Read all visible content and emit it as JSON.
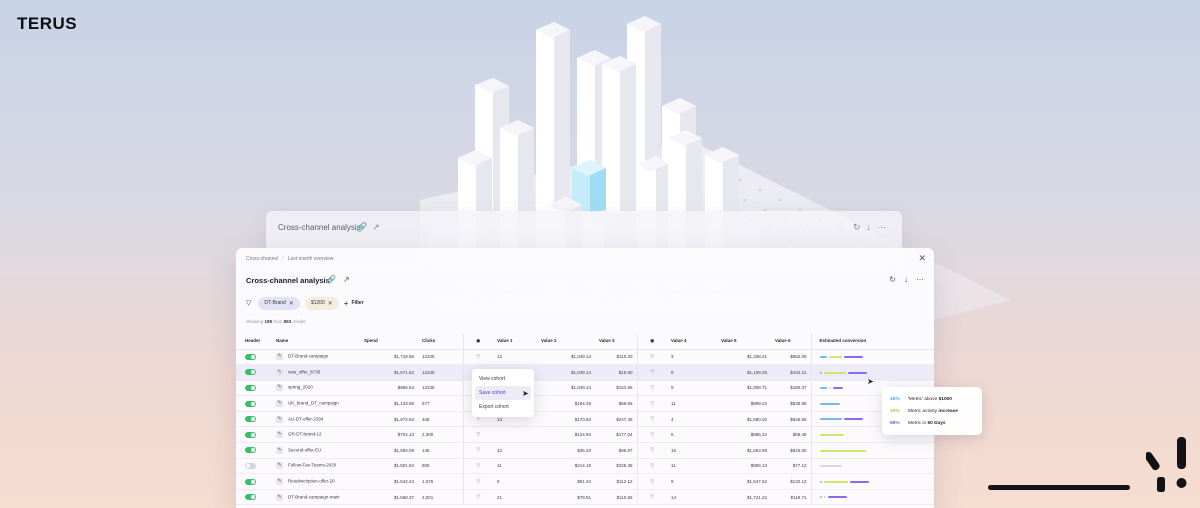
{
  "brand": "TERUS",
  "back_panel": {
    "title": "Cross-channel analysis"
  },
  "breadcrumb": {
    "root": "Cross-channel",
    "current": "Last month overview"
  },
  "panel": {
    "title": "Cross-channel analysis"
  },
  "filters": {
    "chips": [
      "DT-Brand",
      "$1200"
    ],
    "add_label": "Filter"
  },
  "results": {
    "prefix": "Showing",
    "shown": "198",
    "middle": "from",
    "total": "893",
    "suffix": "results"
  },
  "columns": [
    "Header",
    "Name",
    "Spend",
    "Clicks",
    "Value 1",
    "Value 2",
    "Value 3",
    "Value 4",
    "Value 5",
    "Value 6",
    "Estimated conversion"
  ],
  "rows": [
    {
      "on": true,
      "name": "DT-Brand-campaign",
      "spend": "$1,718.56",
      "clicks": "12345",
      "v1": "12",
      "v2": "$1,049.14",
      "v3": "$110.20",
      "v4": "3",
      "v5": "$1,338.21",
      "v6": "$652.08"
    },
    {
      "on": true,
      "name": "new_offer_8735",
      "spend": "$1,571.63",
      "clicks": "12345",
      "v1": "",
      "v2": "$1,049.14",
      "v3": "$15.50",
      "v4": "8",
      "v5": "$1,109.25",
      "v6": "$434.21"
    },
    {
      "on": true,
      "name": "spring_2020",
      "spend": "$956.54",
      "clicks": "12345",
      "v1": "",
      "v2": "$1,049.14",
      "v3": "$154.96",
      "v4": "9",
      "v5": "$1,008.71",
      "v6": "$180.37"
    },
    {
      "on": true,
      "name": "UK_brand_DT_campaign",
      "spend": "$1,133.69",
      "clicks": "677",
      "v1": "",
      "v2": "$194.49",
      "v3": "$69.66",
      "v4": "11",
      "v5": "$899.23",
      "v6": "$538.98"
    },
    {
      "on": true,
      "name": "AU-DT-offer-2394",
      "spend": "$1,672.93",
      "clicks": "348",
      "v1": "13",
      "v2": "$170.63",
      "v3": "$247.49",
      "v4": "4",
      "v5": "$1,580.02",
      "v6": "$945.56"
    },
    {
      "on": true,
      "name": "GR-DT-brand-12",
      "spend": "$704.13",
      "clicks": "2,300",
      "v1": "",
      "v2": "$124.94",
      "v3": "$177.04",
      "v4": "6",
      "v5": "$886.22",
      "v6": "$68.49"
    },
    {
      "on": true,
      "name": "Second-offer-EU",
      "spend": "$1,694.09",
      "clicks": "145",
      "v1": "42",
      "v2": "$35.33",
      "v3": "$95.97",
      "v4": "16",
      "v5": "$1,653.88",
      "v6": "$925.00"
    },
    {
      "on": false,
      "name": "Follow-Fav-Teams-2020",
      "spend": "$1,501.84",
      "clicks": "805",
      "v1": "11",
      "v2": "$214.19",
      "v3": "$226.38",
      "v4": "11",
      "v5": "$956.13",
      "v6": "$77.12"
    },
    {
      "on": true,
      "name": "Resubscription-offer-20",
      "spend": "$1,542.24",
      "clicks": "1,076",
      "v1": "8",
      "v2": "$91.24",
      "v3": "$112.12",
      "v4": "9",
      "v5": "$1,547.62",
      "v6": "$132.12"
    },
    {
      "on": true,
      "name": "DT-Brand-campaign-main",
      "spend": "$1,568.37",
      "clicks": "2,001",
      "v1": "21",
      "v2": "$79.51",
      "v3": "$110.56",
      "v4": "14",
      "v5": "$1,741.22",
      "v6": "$119.71"
    }
  ],
  "conversion": [
    [
      0.15,
      0.28,
      0.4
    ],
    [
      0.03,
      0.45,
      0.4
    ],
    [
      0.15,
      0.05,
      0.2
    ],
    [
      0.42,
      0.0,
      0.0
    ],
    [
      0.45,
      0.0,
      0.4
    ],
    [
      0.0,
      0.5,
      0.0
    ],
    [
      0.0,
      0.95,
      0.0
    ],
    [
      0.0,
      0.0,
      0.0
    ],
    [
      0.02,
      0.5,
      0.4
    ],
    [
      0.02,
      0.05,
      0.4
    ]
  ],
  "context_menu": {
    "items": [
      "View cohort",
      "Save cohort",
      "Export cohort"
    ],
    "active_index": 1
  },
  "tooltip": [
    {
      "pct": "16%",
      "text_before": "'Metric' above ",
      "strong": "$1000",
      "text_after": ""
    },
    {
      "pct": "20%",
      "text_before": "Metric activity ",
      "strong": "increase",
      "text_after": ""
    },
    {
      "pct": "58%",
      "text_before": "Metric in ",
      "strong": "60 Days",
      "text_after": ""
    }
  ],
  "colors": {
    "blue": "#7ab6ee",
    "lime": "#cbe86a",
    "purple": "#8c6be8",
    "toggle_on": "#34c06a",
    "accent": "#4b43c9"
  }
}
